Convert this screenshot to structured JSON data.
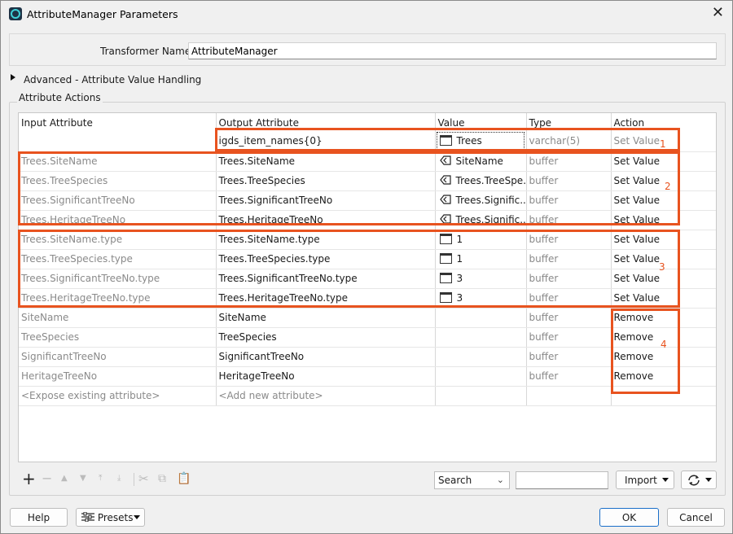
{
  "window": {
    "title": "AttributeManager Parameters"
  },
  "transformer": {
    "name_label": "Transformer Name:",
    "name_value": "AttributeManager"
  },
  "advanced": {
    "label": "Advanced - Attribute Value Handling"
  },
  "actions": {
    "group_label": "Attribute Actions",
    "columns": [
      "Input Attribute",
      "Output Attribute",
      "Value",
      "Type",
      "Action"
    ],
    "rows": [
      {
        "input": "",
        "output": "igds_item_names{0}",
        "value_icon": "constant-icon",
        "value": "Trees",
        "type": "varchar(5)",
        "action": "Set Value"
      },
      {
        "input": "Trees.SiteName",
        "output": "Trees.SiteName",
        "value_icon": "attribute-icon",
        "value": "SiteName",
        "type": "buffer",
        "action": "Set Value"
      },
      {
        "input": "Trees.TreeSpecies",
        "output": "Trees.TreeSpecies",
        "value_icon": "attribute-icon",
        "value": "Trees.TreeSpe...",
        "type": "buffer",
        "action": "Set Value"
      },
      {
        "input": "Trees.SignificantTreeNo",
        "output": "Trees.SignificantTreeNo",
        "value_icon": "attribute-icon",
        "value": "Trees.Signific...",
        "type": "buffer",
        "action": "Set Value"
      },
      {
        "input": "Trees.HeritageTreeNo",
        "output": "Trees.HeritageTreeNo",
        "value_icon": "attribute-icon",
        "value": "Trees.Signific...",
        "type": "buffer",
        "action": "Set Value"
      },
      {
        "input": "Trees.SiteName.type",
        "output": "Trees.SiteName.type",
        "value_icon": "constant-icon",
        "value": "1",
        "type": "buffer",
        "action": "Set Value"
      },
      {
        "input": "Trees.TreeSpecies.type",
        "output": "Trees.TreeSpecies.type",
        "value_icon": "constant-icon",
        "value": "1",
        "type": "buffer",
        "action": "Set Value"
      },
      {
        "input": "Trees.SignificantTreeNo.type",
        "output": "Trees.SignificantTreeNo.type",
        "value_icon": "constant-icon",
        "value": "3",
        "type": "buffer",
        "action": "Set Value"
      },
      {
        "input": "Trees.HeritageTreeNo.type",
        "output": "Trees.HeritageTreeNo.type",
        "value_icon": "constant-icon",
        "value": "3",
        "type": "buffer",
        "action": "Set Value"
      },
      {
        "input": "SiteName",
        "output": "SiteName",
        "value_icon": "",
        "value": "",
        "type": "buffer",
        "action": "Remove"
      },
      {
        "input": "TreeSpecies",
        "output": "TreeSpecies",
        "value_icon": "",
        "value": "",
        "type": "buffer",
        "action": "Remove"
      },
      {
        "input": "SignificantTreeNo",
        "output": "SignificantTreeNo",
        "value_icon": "",
        "value": "",
        "type": "buffer",
        "action": "Remove"
      },
      {
        "input": "HeritageTreeNo",
        "output": "HeritageTreeNo",
        "value_icon": "",
        "value": "",
        "type": "buffer",
        "action": "Remove"
      },
      {
        "input": "<Expose existing attribute>",
        "output": "<Add new attribute>",
        "value_icon": "",
        "value": "",
        "type": "",
        "action": ""
      }
    ]
  },
  "annotations": [
    "1",
    "2",
    "3",
    "4"
  ],
  "toolbar": {
    "search_value": "Search",
    "search_placeholder": "",
    "import_label": "Import"
  },
  "footer": {
    "help": "Help",
    "presets": "Presets",
    "ok": "OK",
    "cancel": "Cancel"
  },
  "colors": {
    "highlight": "#e8531f",
    "ok_border": "#1a6fc9"
  }
}
